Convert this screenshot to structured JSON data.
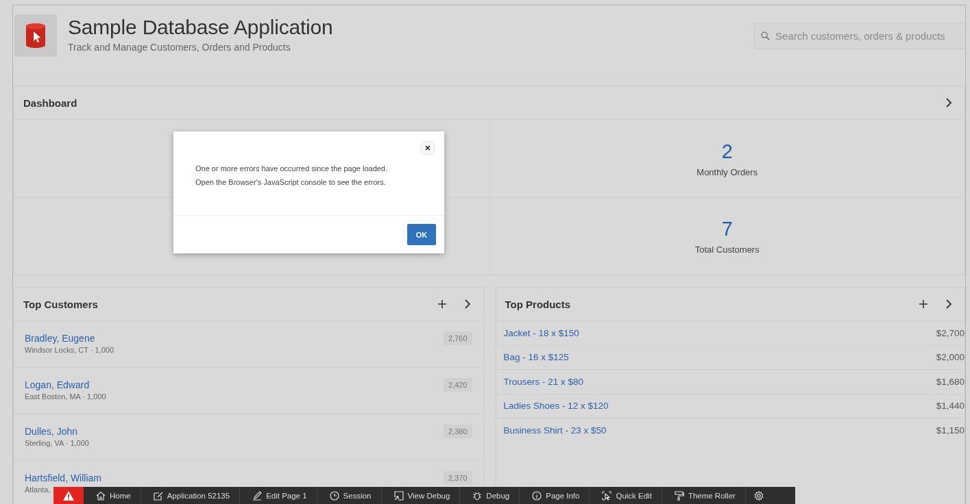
{
  "app": {
    "title": "Sample Database Application",
    "subtitle": "Track and Manage Customers, Orders and Products"
  },
  "search": {
    "placeholder": "Search customers, orders & products"
  },
  "dashboard": {
    "title": "Dashboard",
    "metrics": [
      {
        "value": "2",
        "label": "Monthly Orders"
      },
      {
        "value": "7",
        "label": "Total Customers"
      }
    ]
  },
  "customers": {
    "title": "Top Customers",
    "rows": [
      {
        "name": "Bradley, Eugene",
        "detail": "Windsor Locks, CT · 1,000",
        "amount": "2,760"
      },
      {
        "name": "Logan, Edward",
        "detail": "East Boston, MA · 1,000",
        "amount": "2,420"
      },
      {
        "name": "Dulles, John",
        "detail": "Sterling, VA · 1,000",
        "amount": "2,380"
      },
      {
        "name": "Hartsfield, William",
        "detail": "Atlanta,",
        "amount": "2,370"
      }
    ]
  },
  "products": {
    "title": "Top Products",
    "rows": [
      {
        "label": "Jacket - 18 x $150",
        "amount": "$2,700"
      },
      {
        "label": "Bag - 16 x $125",
        "amount": "$2,000"
      },
      {
        "label": "Trousers - 21 x $80",
        "amount": "$1,680"
      },
      {
        "label": "Ladies Shoes - 12 x $120",
        "amount": "$1,440"
      },
      {
        "label": "Business Shirt - 23 x $50",
        "amount": "$1,150"
      }
    ]
  },
  "dialog": {
    "lines": [
      "One or more errors have occurred since the page loaded.",
      "Open the Browser's JavaScript console to see the errors."
    ],
    "button": "OK"
  },
  "dev_toolbar": {
    "items": [
      {
        "kind": "home",
        "label": "Home"
      },
      {
        "kind": "app",
        "label": "Application 52135"
      },
      {
        "kind": "edit",
        "label": "Edit Page 1"
      },
      {
        "kind": "session",
        "label": "Session"
      },
      {
        "kind": "view-debug",
        "label": "View Debug"
      },
      {
        "kind": "debug",
        "label": "Debug"
      },
      {
        "kind": "info",
        "label": "Page Info"
      },
      {
        "kind": "quick-edit",
        "label": "Quick Edit"
      },
      {
        "kind": "theme",
        "label": "Theme Roller"
      }
    ]
  }
}
